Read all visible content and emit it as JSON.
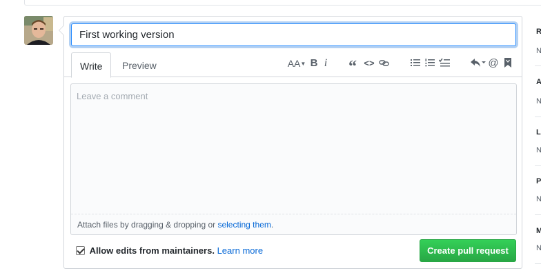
{
  "title_input": {
    "value": "First working version"
  },
  "tabs": [
    {
      "label": "Write"
    },
    {
      "label": "Preview"
    }
  ],
  "toolbar": {
    "heading": "AA",
    "bold": "B",
    "italic": "i",
    "quote": "“",
    "code": "<>",
    "mention": "@"
  },
  "comment": {
    "placeholder": "Leave a comment",
    "attach_prefix": "Attach files by dragging & dropping or ",
    "attach_link": "selecting them",
    "attach_suffix": "."
  },
  "footer": {
    "allow_label": "Allow edits from maintainers.",
    "learn_more": "Learn more",
    "create_button": "Create pull request"
  },
  "sidebar": {
    "items": [
      {
        "head": "R",
        "value": "N"
      },
      {
        "head": "A",
        "value": "N"
      },
      {
        "head": "La",
        "value": "N"
      },
      {
        "head": "P",
        "value": "N"
      },
      {
        "head": "M",
        "value": "N"
      }
    ]
  },
  "colors": {
    "accent": "#0366d6",
    "primary_button": "#28a745",
    "focus_border": "#2188ff"
  }
}
